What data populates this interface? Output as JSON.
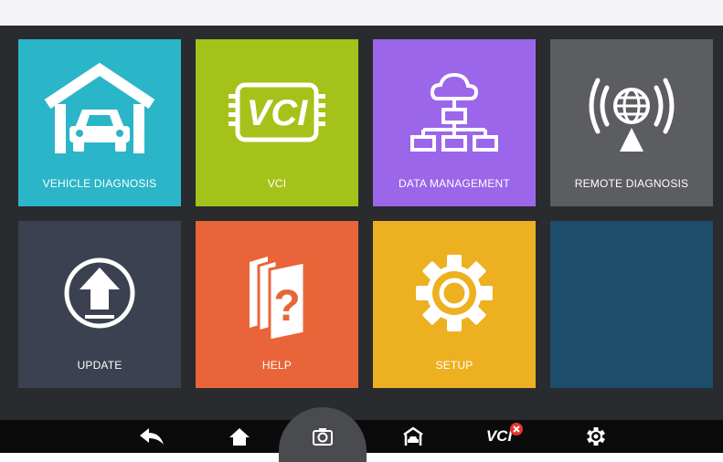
{
  "tiles": [
    {
      "label": "VEHICLE DIAGNOSIS",
      "icon": "garage-car-icon",
      "color": "#2bb5c8"
    },
    {
      "label": "VCI",
      "icon": "vci-chip-icon",
      "color": "#a5c21a"
    },
    {
      "label": "DATA MANAGEMENT",
      "icon": "cloud-network-icon",
      "color": "#9b66ea"
    },
    {
      "label": "REMOTE DIAGNOSIS",
      "icon": "remote-globe-icon",
      "color": "#5c5d61"
    },
    {
      "label": "UPDATE",
      "icon": "upload-arrow-icon",
      "color": "#3b4150"
    },
    {
      "label": "HELP",
      "icon": "help-books-icon",
      "color": "#e96539"
    },
    {
      "label": "SETUP",
      "icon": "gear-icon",
      "color": "#edb021"
    },
    {
      "label": "",
      "icon": "",
      "color": "#1c4e6b"
    }
  ],
  "navbar": {
    "vci_label": "VCI",
    "items": [
      "back-icon",
      "home-icon",
      "camera-icon",
      "vehicle-icon",
      "vci-status-icon",
      "settings-icon"
    ]
  }
}
